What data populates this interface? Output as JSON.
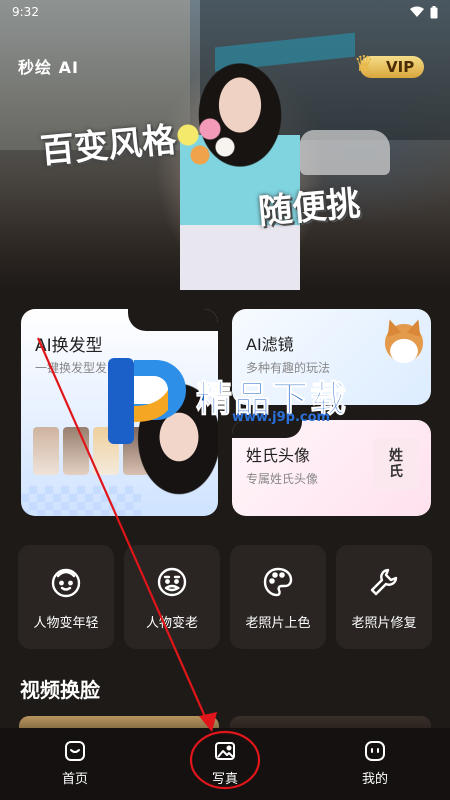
{
  "status_bar": {
    "time": "9:32"
  },
  "hero": {
    "app_name": "秒绘 AI",
    "slogan_line1": "百变风格",
    "slogan_line2": "随便挑",
    "vip_label": "VIP"
  },
  "features": {
    "hair": {
      "title": "AI换发型",
      "subtitle": "一键换发型发"
    },
    "filter": {
      "title": "AI滤镜",
      "subtitle": "多种有趣的玩法"
    },
    "surname": {
      "title": "姓氏头像",
      "subtitle": "专属姓氏头像",
      "preview_char1": "姓",
      "preview_char2": "氏"
    }
  },
  "tools": [
    {
      "label": "人物变年轻",
      "icon": "young-face-icon"
    },
    {
      "label": "人物变老",
      "icon": "old-face-icon"
    },
    {
      "label": "老照片上色",
      "icon": "palette-icon"
    },
    {
      "label": "老照片修复",
      "icon": "wrench-icon"
    }
  ],
  "section": {
    "title": "视频换脸"
  },
  "bottom_nav": [
    {
      "label": "首页",
      "icon": "home-icon"
    },
    {
      "label": "写真",
      "icon": "photo-icon"
    },
    {
      "label": "我的",
      "icon": "profile-icon"
    }
  ],
  "watermark": {
    "text": "精品下载",
    "url": "www.j9p.com"
  },
  "colors": {
    "background": "#1e1a17",
    "card": "#2a2522",
    "nav": "#141110",
    "annotation": "#e0161b",
    "vip_gold": "#e8b94a"
  }
}
